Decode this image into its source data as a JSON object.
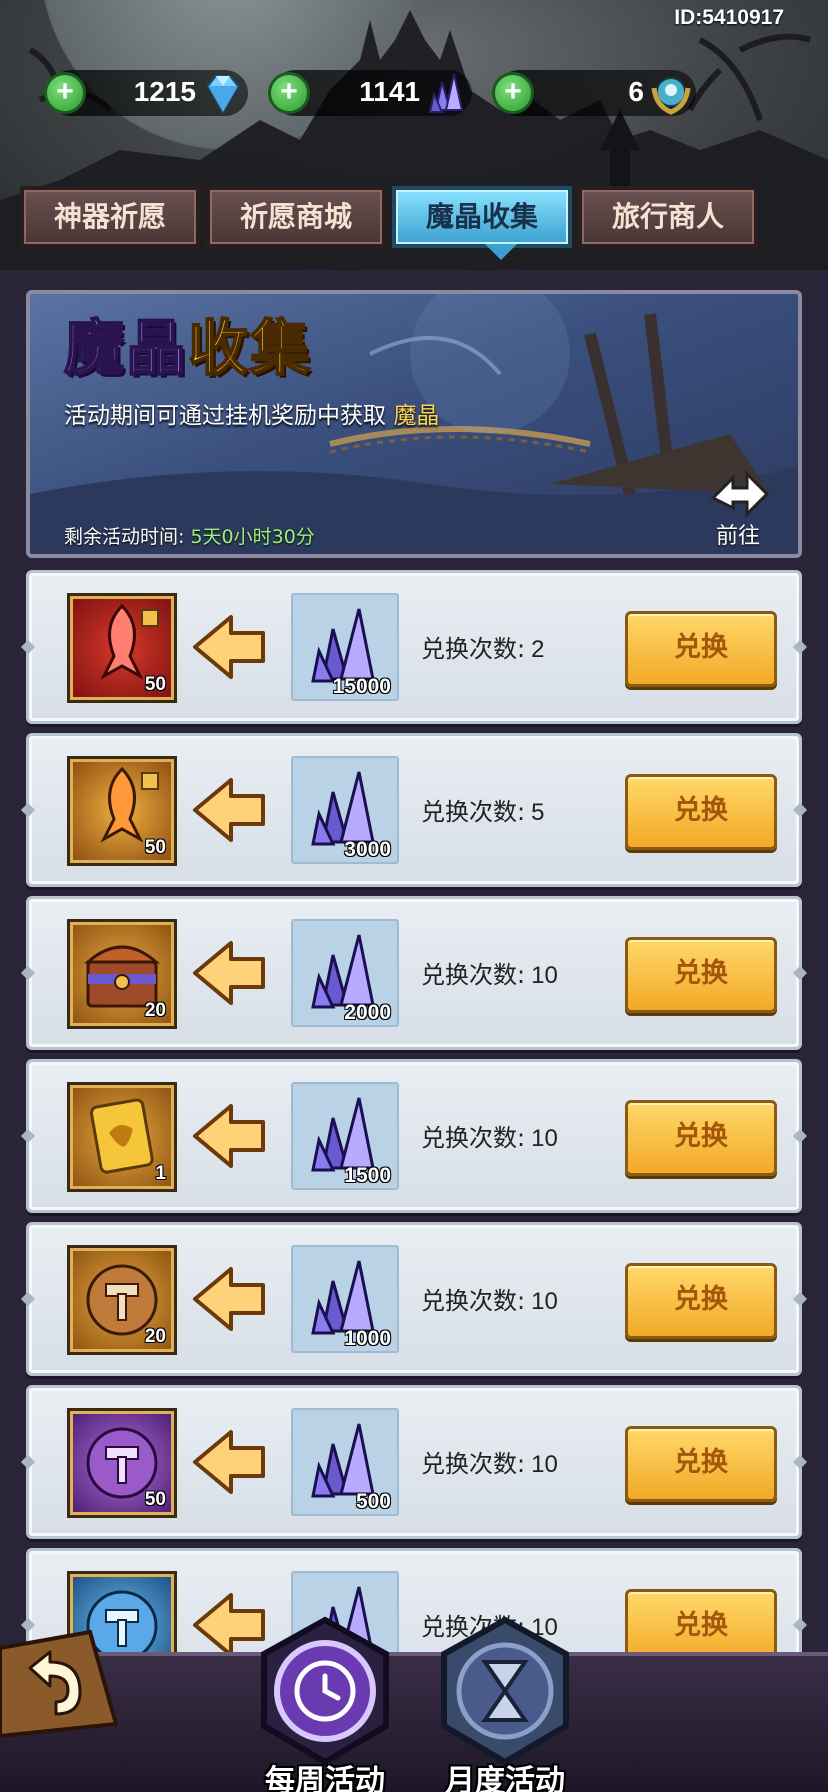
{
  "player_id": "ID:5410917",
  "currencies": [
    {
      "amount": "1215",
      "icon": "diamond-icon",
      "color": "#7ad0ff"
    },
    {
      "amount": "1141",
      "icon": "magic-crystal-icon",
      "color": "#9a8cff"
    },
    {
      "amount": "6",
      "icon": "laurel-badge-icon",
      "color": "#4ab0c8"
    }
  ],
  "tabs": [
    {
      "label": "神器祈愿",
      "active": false
    },
    {
      "label": "祈愿商城",
      "active": false
    },
    {
      "label": "魔晶收集",
      "active": true
    },
    {
      "label": "旅行商人",
      "active": false
    }
  ],
  "banner": {
    "title_part1": "魔晶",
    "title_part2": "收集",
    "desc_prefix": "活动期间可通过挂机奖励中获取",
    "desc_highlight": "魔晶",
    "time_label": "剩余活动时间:",
    "time_value": "5天0小时30分",
    "goto_label": "前往"
  },
  "exchange_rows": [
    {
      "reward_icon": "red-artifact-shard-icon",
      "reward_qty": "50",
      "cost_icon": "magic-crystal-icon",
      "cost_qty": "15000",
      "times_label": "兑换次数:",
      "times": "2",
      "button": "兑换"
    },
    {
      "reward_icon": "gold-artifact-shard-icon",
      "reward_qty": "50",
      "cost_icon": "magic-crystal-icon",
      "cost_qty": "3000",
      "times_label": "兑换次数:",
      "times": "5",
      "button": "兑换"
    },
    {
      "reward_icon": "treasure-chest-icon",
      "reward_qty": "20",
      "cost_icon": "magic-crystal-icon",
      "cost_qty": "2000",
      "times_label": "兑换次数:",
      "times": "10",
      "button": "兑换"
    },
    {
      "reward_icon": "golden-card-icon",
      "reward_qty": "1",
      "cost_icon": "magic-crystal-icon",
      "cost_qty": "1500",
      "times_label": "兑换次数:",
      "times": "10",
      "button": "兑换"
    },
    {
      "reward_icon": "bronze-hammer-coin-icon",
      "reward_qty": "20",
      "cost_icon": "magic-crystal-icon",
      "cost_qty": "1000",
      "times_label": "兑换次数:",
      "times": "10",
      "button": "兑换"
    },
    {
      "reward_icon": "purple-hammer-coin-icon",
      "reward_qty": "50",
      "cost_icon": "magic-crystal-icon",
      "cost_qty": "500",
      "times_label": "兑换次数:",
      "times": "10",
      "button": "兑换"
    },
    {
      "reward_icon": "blue-hammer-coin-icon",
      "reward_qty": "",
      "cost_icon": "magic-crystal-icon",
      "cost_qty": "",
      "times_label": "兑换次数:",
      "times": "10",
      "button": "兑换"
    }
  ],
  "bottom_nav": [
    {
      "label": "每周活动",
      "icon": "clock-emblem-icon",
      "active": true
    },
    {
      "label": "月度活动",
      "icon": "hourglass-emblem-icon",
      "active": false
    }
  ],
  "colors": {
    "accent_gold": "#f2a927",
    "tab_active": "#3aa0cf",
    "tab_inactive": "#4a3535",
    "highlight_text": "#ffd34a",
    "time_text": "#9ff07a"
  }
}
